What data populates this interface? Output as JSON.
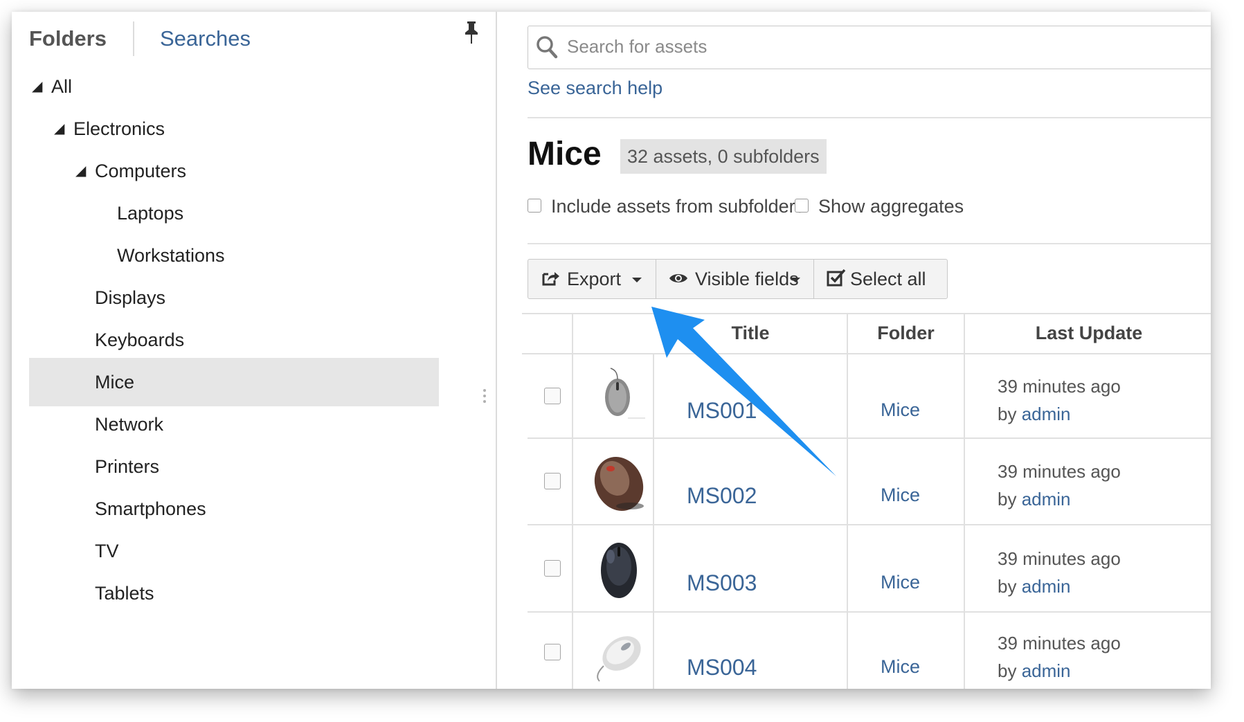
{
  "sidebar": {
    "tabs": {
      "folders": "Folders",
      "searches": "Searches"
    },
    "pin_icon": "pushpin-icon",
    "tree": [
      {
        "label": "All",
        "expanded": true,
        "triangle": "◢"
      },
      {
        "label": "Electronics",
        "expanded": true,
        "triangle": "◢"
      },
      {
        "label": "Computers",
        "expanded": true,
        "triangle": "◢"
      },
      {
        "label": "Laptops"
      },
      {
        "label": "Workstations"
      },
      {
        "label": "Displays"
      },
      {
        "label": "Keyboards"
      },
      {
        "label": "Mice",
        "selected": true
      },
      {
        "label": "Network"
      },
      {
        "label": "Printers"
      },
      {
        "label": "Smartphones"
      },
      {
        "label": "TV"
      },
      {
        "label": "Tablets"
      }
    ]
  },
  "search": {
    "placeholder": "Search for assets",
    "value": "",
    "help_link": "See search help"
  },
  "folder": {
    "title": "Mice",
    "badge": "32 assets, 0 subfolders",
    "include_subfolders_label": "Include assets from subfolders",
    "show_aggregates_label": "Show aggregates"
  },
  "toolbar": {
    "export_label": "Export",
    "visible_fields_label": "Visible fields",
    "select_all_label": "Select all"
  },
  "table": {
    "columns": [
      "",
      "",
      "Title",
      "Folder",
      "Last Update"
    ],
    "rows": [
      {
        "title": "MS001",
        "folder": "Mice",
        "updated": "39 minutes ago",
        "by_prefix": "by",
        "by_user": "admin",
        "thumb": "mouse-gray"
      },
      {
        "title": "MS002",
        "folder": "Mice",
        "updated": "39 minutes ago",
        "by_prefix": "by",
        "by_user": "admin",
        "thumb": "mouse-bronze"
      },
      {
        "title": "MS003",
        "folder": "Mice",
        "updated": "39 minutes ago",
        "by_prefix": "by",
        "by_user": "admin",
        "thumb": "mouse-black"
      },
      {
        "title": "MS004",
        "folder": "Mice",
        "updated": "39 minutes ago",
        "by_prefix": "by",
        "by_user": "admin",
        "thumb": "mouse-white"
      }
    ]
  },
  "colors": {
    "link": "#3a6597",
    "selected_row": "#e6e6e6",
    "badge_bg": "#e3e3e3",
    "annotation_arrow": "#1e8ff0"
  }
}
